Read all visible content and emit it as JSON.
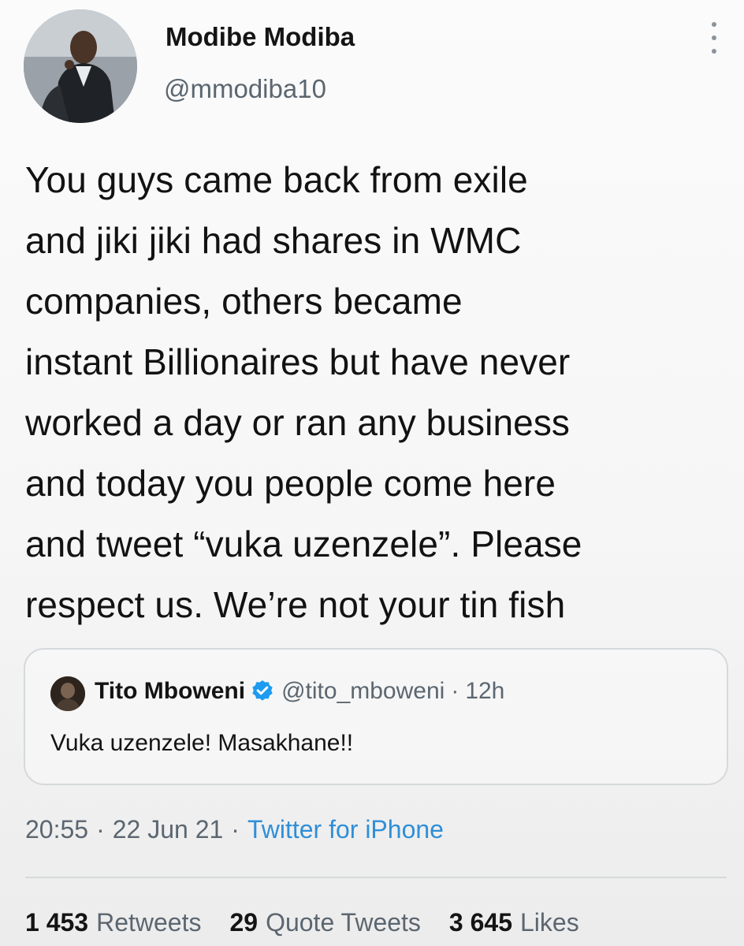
{
  "author": {
    "name": "Modibe Modiba",
    "handle": "@mmodiba10"
  },
  "tweet": {
    "text": "You guys came back from exile\nand jiki jiki had shares in WMC\ncompanies, others became\ninstant Billionaires but have never\nworked a day or ran any business\nand today you people come here\nand tweet “vuka uzenzele”. Please\nrespect us. We’re not your tin fish"
  },
  "quoted_tweet": {
    "name": "Tito Mboweni",
    "handle": "@tito_mboweni",
    "separator": "·",
    "time": "12h",
    "text": "Vuka uzenzele! Masakhane!!",
    "verified": true
  },
  "meta": {
    "time": "20:55",
    "separator": "·",
    "date": "22 Jun 21",
    "source": "Twitter for iPhone"
  },
  "stats": {
    "retweets_count": "1 453",
    "retweets_label": "Retweets",
    "quotes_count": "29",
    "quotes_label": "Quote Tweets",
    "likes_count": "3 645",
    "likes_label": "Likes"
  },
  "icons": {
    "more": "more-vertical-icon",
    "verified": "verified-badge-icon"
  },
  "colors": {
    "link_blue": "#2f8fd8",
    "verified_blue": "#1d9bf0",
    "secondary_text": "#5b6670"
  }
}
